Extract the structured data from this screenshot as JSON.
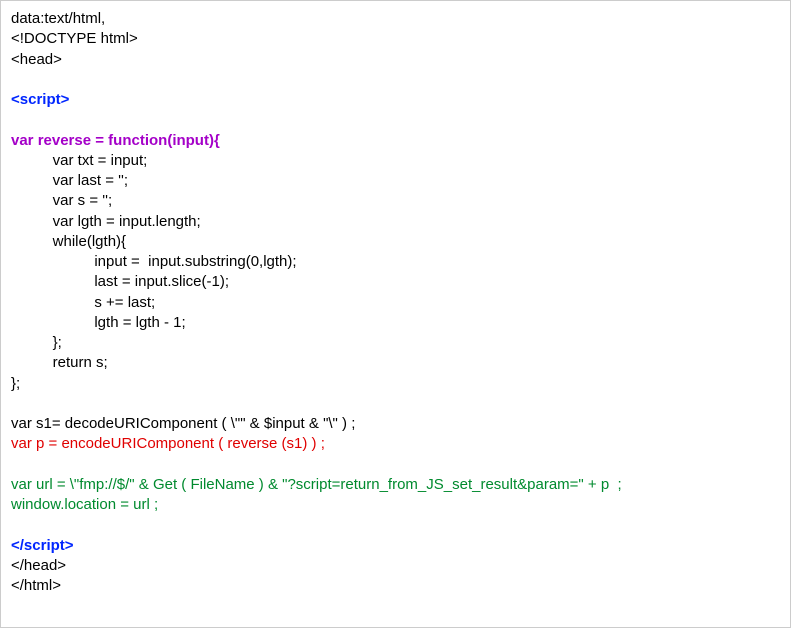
{
  "lines": [
    {
      "cls": "c-black",
      "text": "data:text/html,"
    },
    {
      "cls": "c-black",
      "text": "<!DOCTYPE html>"
    },
    {
      "cls": "c-black",
      "text": "<head>"
    },
    {
      "cls": "",
      "text": ""
    },
    {
      "cls": "c-blue",
      "text": "<script>"
    },
    {
      "cls": "",
      "text": ""
    },
    {
      "cls": "c-purple",
      "text": "var reverse = function(input){"
    },
    {
      "cls": "c-black",
      "text": "          var txt = input;"
    },
    {
      "cls": "c-black",
      "text": "          var last = '';"
    },
    {
      "cls": "c-black",
      "text": "          var s = '';"
    },
    {
      "cls": "c-black",
      "text": "          var lgth = input.length;"
    },
    {
      "cls": "c-black",
      "text": "          while(lgth){"
    },
    {
      "cls": "c-black",
      "text": "                    input =  input.substring(0,lgth);"
    },
    {
      "cls": "c-black",
      "text": "                    last = input.slice(-1);"
    },
    {
      "cls": "c-black",
      "text": "                    s += last;"
    },
    {
      "cls": "c-black",
      "text": "                    lgth = lgth - 1;"
    },
    {
      "cls": "c-black",
      "text": "          };"
    },
    {
      "cls": "c-black",
      "text": "          return s;"
    },
    {
      "cls": "c-black",
      "text": "};"
    },
    {
      "cls": "",
      "text": ""
    },
    {
      "cls": "c-black",
      "text": "var s1= decodeURIComponent ( \\\"\" & $input & \"\\\" ) ;"
    },
    {
      "cls": "c-red",
      "text": "var p = encodeURIComponent ( reverse (s1) ) ;"
    },
    {
      "cls": "",
      "text": ""
    },
    {
      "cls": "c-green",
      "text": "var url = \\\"fmp://$/\" & Get ( FileName ) & \"?script=return_from_JS_set_result&param=\" + p  ;"
    },
    {
      "cls": "c-green",
      "text": "window.location = url ;"
    },
    {
      "cls": "",
      "text": ""
    },
    {
      "cls": "c-blue",
      "text": "</script>"
    },
    {
      "cls": "c-black",
      "text": "</head>"
    },
    {
      "cls": "c-black",
      "text": "</html>"
    }
  ]
}
